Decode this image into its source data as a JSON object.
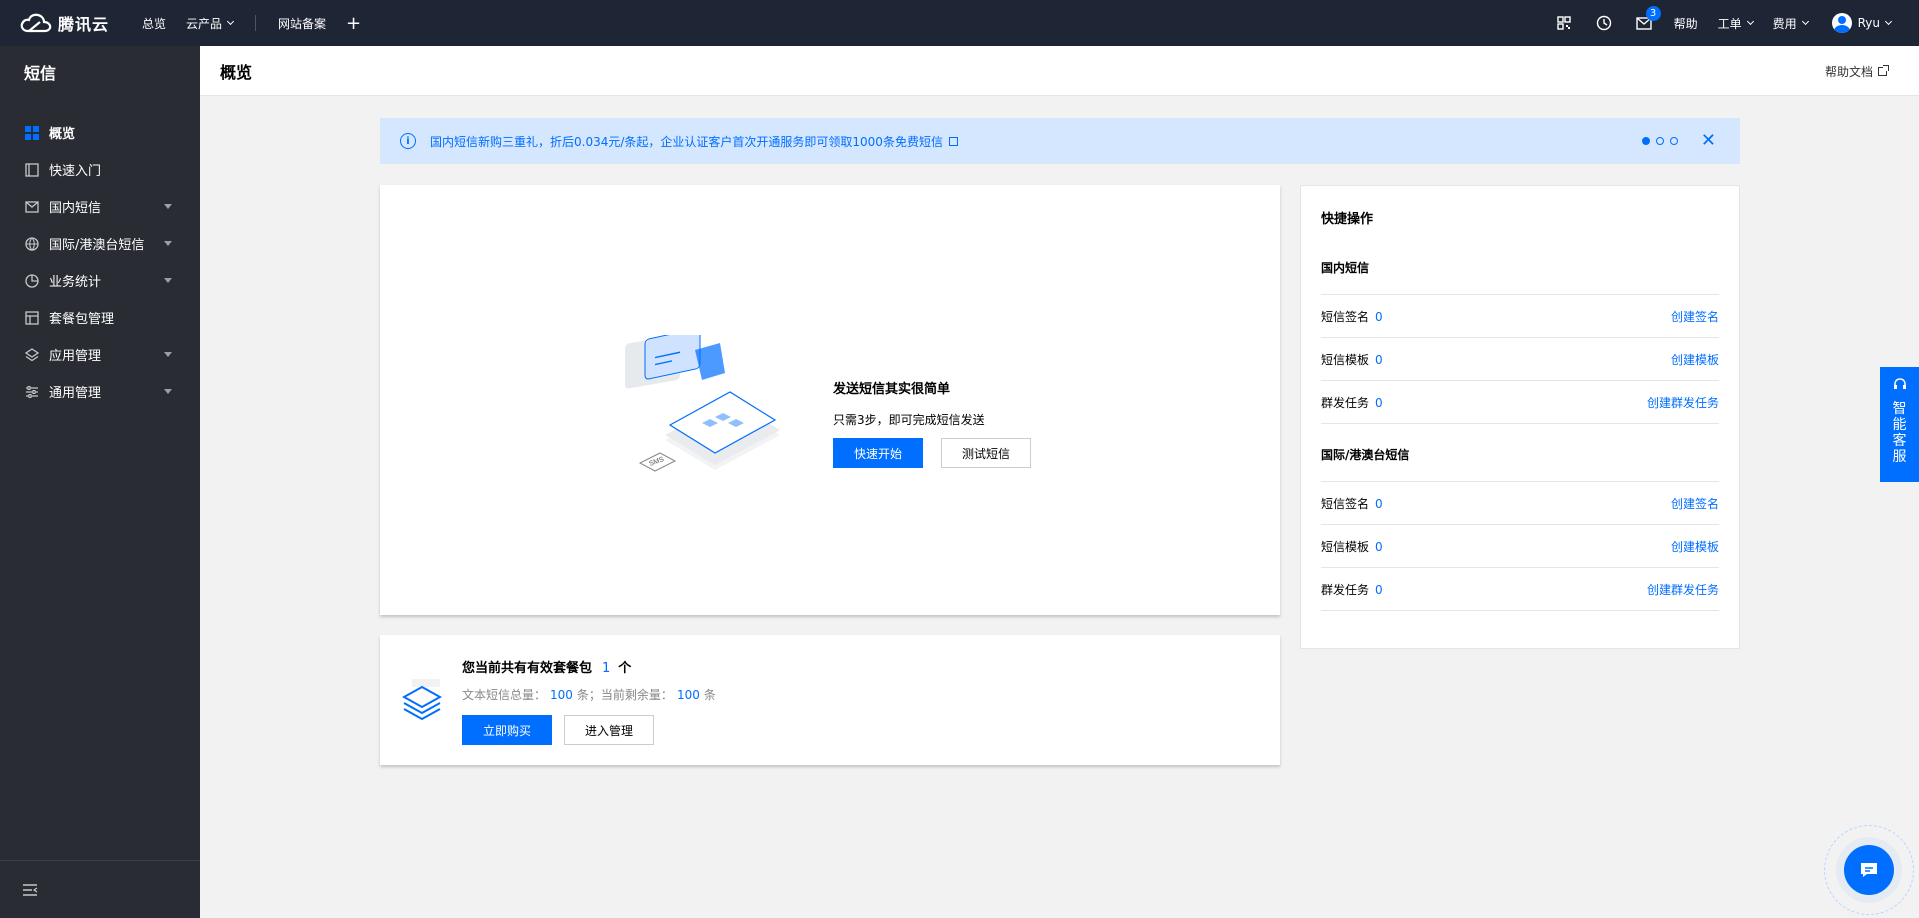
{
  "topbar": {
    "brand": "腾讯云",
    "nav": [
      {
        "label": "总览"
      },
      {
        "label": "云产品"
      },
      {
        "label": "网站备案"
      }
    ],
    "plus": "+",
    "mail_badge": "3",
    "help": "帮助",
    "ticket": "工单",
    "billing": "费用",
    "user": "Ryu"
  },
  "sidebar": {
    "title": "短信",
    "items": [
      {
        "label": "概览",
        "icon": "grid-icon"
      },
      {
        "label": "快速入门",
        "icon": "book-icon"
      },
      {
        "label": "国内短信",
        "icon": "mail-icon"
      },
      {
        "label": "国际/港澳台短信",
        "icon": "globe-icon"
      },
      {
        "label": "业务统计",
        "icon": "pie-chart-icon"
      },
      {
        "label": "套餐包管理",
        "icon": "package-icon"
      },
      {
        "label": "应用管理",
        "icon": "layers-icon"
      },
      {
        "label": "通用管理",
        "icon": "sliders-icon"
      }
    ]
  },
  "header": {
    "title": "概览",
    "help_doc": "帮助文档"
  },
  "notice": {
    "text": "国内短信新购三重礼，折后0.034元/条起，企业认证客户首次开通服务即可领取1000条免费短信",
    "close": "✕"
  },
  "intro": {
    "title": "发送短信其实很简单",
    "desc": "只需3步，即可完成短信发送",
    "primary_btn": "快速开始",
    "secondary_btn": "测试短信"
  },
  "package": {
    "title_prefix": "您当前共有有效套餐包",
    "count": "1",
    "title_suffix": "个",
    "desc_total_label": "文本短信总量：",
    "desc_total_value": "100",
    "desc_mid": "条；当前剩余量：",
    "desc_remain_value": "100",
    "desc_unit": "条",
    "buy_btn": "立即购买",
    "manage_btn": "进入管理"
  },
  "quick": {
    "title": "快捷操作",
    "domestic": {
      "title": "国内短信",
      "rows": [
        {
          "label": "短信签名",
          "count": "0",
          "action": "创建签名"
        },
        {
          "label": "短信模板",
          "count": "0",
          "action": "创建模板"
        },
        {
          "label": "群发任务",
          "count": "0",
          "action": "创建群发任务"
        }
      ]
    },
    "intl": {
      "title": "国际/港澳台短信",
      "rows": [
        {
          "label": "短信签名",
          "count": "0",
          "action": "创建签名"
        },
        {
          "label": "短信模板",
          "count": "0",
          "action": "创建模板"
        },
        {
          "label": "群发任务",
          "count": "0",
          "action": "创建群发任务"
        }
      ]
    }
  },
  "float_service": {
    "chars": [
      "智",
      "能",
      "客",
      "服"
    ]
  },
  "colors": {
    "brand": "#006eff",
    "topbar": "#1e2534",
    "sidebar": "#292d33"
  }
}
